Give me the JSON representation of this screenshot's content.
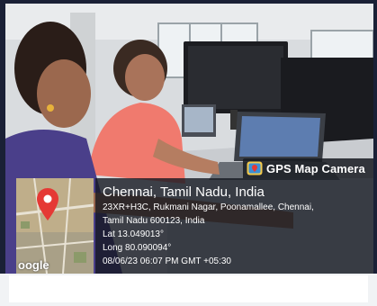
{
  "badge": {
    "title": "GPS Map Camera",
    "icon": "gps-map-camera-icon"
  },
  "location": {
    "city": "Chennai, Tamil Nadu, India",
    "address_line1": "23XR+H3C, Rukmani Nagar, Poonamallee, Chennai,",
    "address_line2": "Tamil Nadu 600123, India",
    "latitude": "Lat 13.049013°",
    "longitude": "Long 80.090094°",
    "timestamp": "08/06/23 06:07 PM GMT +05:30"
  },
  "map": {
    "brand": "oogle",
    "pin_icon": "location-pin-icon"
  },
  "colors": {
    "pin": "#e53935",
    "overlay": "#14181f",
    "background": "#1a2036"
  }
}
